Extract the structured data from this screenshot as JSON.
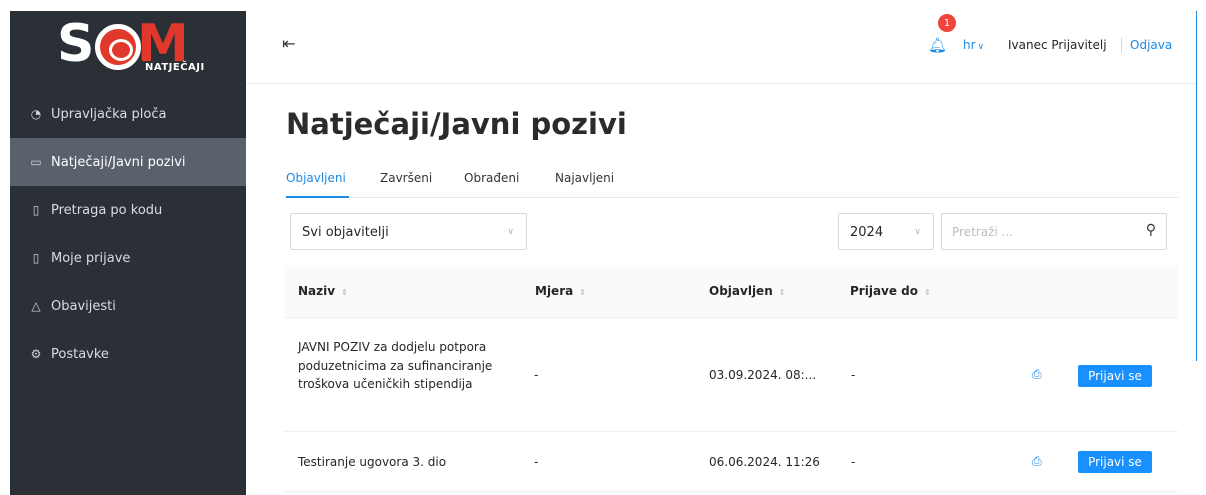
{
  "brand": {
    "logo_letters": [
      "S",
      "M"
    ],
    "logo_sub": "NATJEČAJI"
  },
  "sidebar": {
    "items": [
      {
        "label": "Upravljačka ploča",
        "icon": "pie-chart-icon",
        "glyph": "◔"
      },
      {
        "label": "Natječaji/Javni pozivi",
        "icon": "folder-open-icon",
        "glyph": "▭"
      },
      {
        "label": "Pretraga po kodu",
        "icon": "file-search-icon",
        "glyph": "▯"
      },
      {
        "label": "Moje prijave",
        "icon": "file-icon",
        "glyph": "▯"
      },
      {
        "label": "Obavijesti",
        "icon": "bell-icon",
        "glyph": "△"
      },
      {
        "label": "Postavke",
        "icon": "gear-icon",
        "glyph": "⚙"
      }
    ],
    "active_index": 1
  },
  "header": {
    "collapse_icon": "menu-fold-icon",
    "notification_count": "1",
    "language": "hr",
    "user_name": "Ivanec Prijavitelj",
    "logout_label": "Odjava"
  },
  "main": {
    "title": "Natječaji/Javni pozivi",
    "tabs": [
      "Objavljeni",
      "Završeni",
      "Obrađeni",
      "Najavljeni"
    ],
    "active_tab": 0,
    "filters": {
      "publisher": "Svi objavitelji",
      "year": "2024",
      "search_placeholder": "Pretraži ..."
    }
  },
  "table": {
    "columns": [
      "Naziv",
      "Mjera",
      "Objavljen",
      "Prijave do"
    ],
    "rows": [
      {
        "naziv": "JAVNI POZIV za dodjelu potpora poduzetnicima za sufinanciranje troškova učeničkih stipendija",
        "mjera": "-",
        "objavljen": "03.09.2024. 08:...",
        "prijave_do": "-",
        "action": "Prijavi se"
      },
      {
        "naziv": "Testiranje ugovora 3. dio",
        "mjera": "-",
        "objavljen": "06.06.2024. 11:26",
        "prijave_do": "-",
        "action": "Prijavi se"
      }
    ]
  },
  "colors": {
    "accent": "#1890ff",
    "sidebar_bg": "#2a3036",
    "sidebar_active": "#59626c",
    "brand_red": "#e0392b"
  }
}
